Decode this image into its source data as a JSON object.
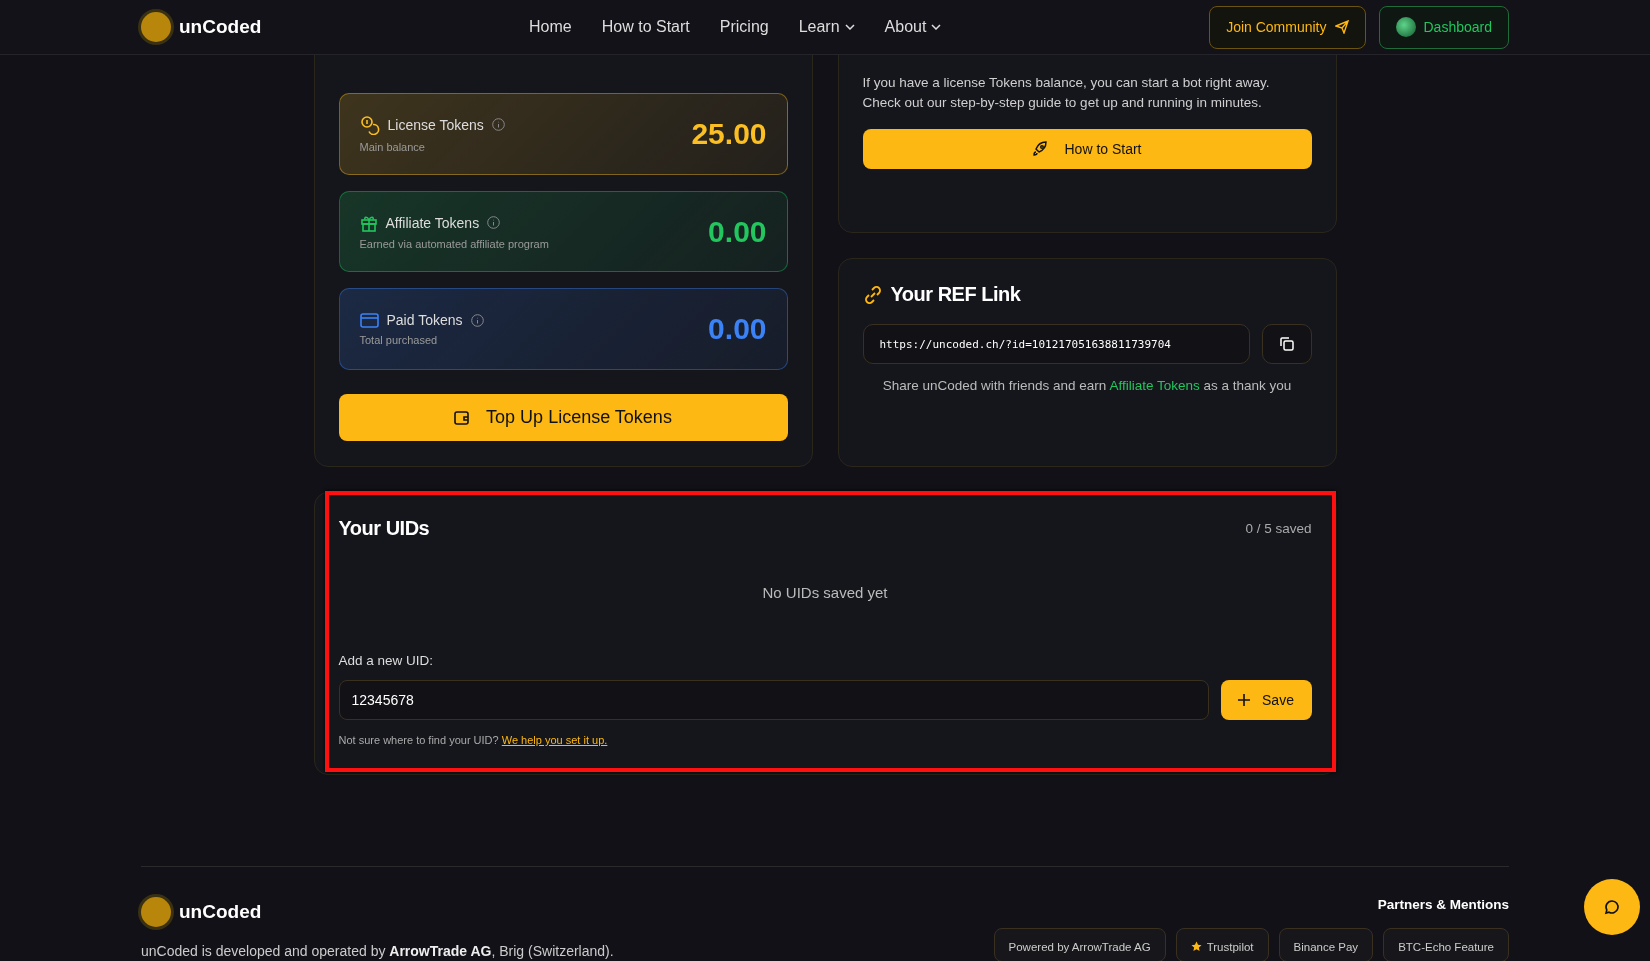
{
  "nav": {
    "brand": "unCoded",
    "links": [
      {
        "label": "Home",
        "dropdown": false
      },
      {
        "label": "How to Start",
        "dropdown": false
      },
      {
        "label": "Pricing",
        "dropdown": false
      },
      {
        "label": "Learn",
        "dropdown": true
      },
      {
        "label": "About",
        "dropdown": true
      }
    ],
    "actions": [
      {
        "label": "Join Community",
        "kind": "community"
      },
      {
        "label": "Dashboard",
        "kind": "dashboard"
      }
    ]
  },
  "balances": {
    "cards": [
      {
        "kind": "license",
        "title": "License Tokens",
        "subtitle": "Main balance",
        "amount": "25.00",
        "color": "#fbbf24"
      },
      {
        "kind": "affiliate",
        "title": "Affiliate Tokens",
        "subtitle": "Earned via automated affiliate program",
        "amount": "0.00",
        "color": "#22c55e"
      },
      {
        "kind": "paid",
        "title": "Paid Tokens",
        "subtitle": "Total purchased",
        "amount": "0.00",
        "color": "#3b82f6"
      }
    ],
    "button": "Top Up License Tokens"
  },
  "start": {
    "lines": [
      "If you have a license Tokens balance, you can start a bot right away.",
      "Check out our step-by-step guide to get up and running in minutes."
    ],
    "button": "How to Start"
  },
  "ref": {
    "title": "Your REF Link",
    "url": "https://uncoded.ch/?id=101217051638811739704",
    "note_before": "Share unCoded with friends and earn",
    "note_highlight": "Affiliate Tokens",
    "note_after": "as a thank you"
  },
  "uids": {
    "title": "Your UIDs",
    "count": "0 / 5 saved",
    "empty": "No UIDs saved yet",
    "label": "Add a new UID:",
    "value": "12345678",
    "button": "Save",
    "help": "Not sure where to find your UID?",
    "help_link": "We help you set it up.",
    "highlighted": true
  },
  "footer": {
    "brand": "unCoded",
    "about": "unCoded is developed and operated by **ArrowTrade AG**, Brig (Switzerland).",
    "partners_title": "Partners & Mentions",
    "partners": [
      {
        "label": "Powered by ArrowTrade AG",
        "kind": "plain"
      },
      {
        "label": "Trustpilot",
        "kind": "star"
      },
      {
        "label": "Binance Pay",
        "kind": "plain"
      },
      {
        "label": "BTC-Echo Feature",
        "kind": "plain"
      }
    ]
  }
}
